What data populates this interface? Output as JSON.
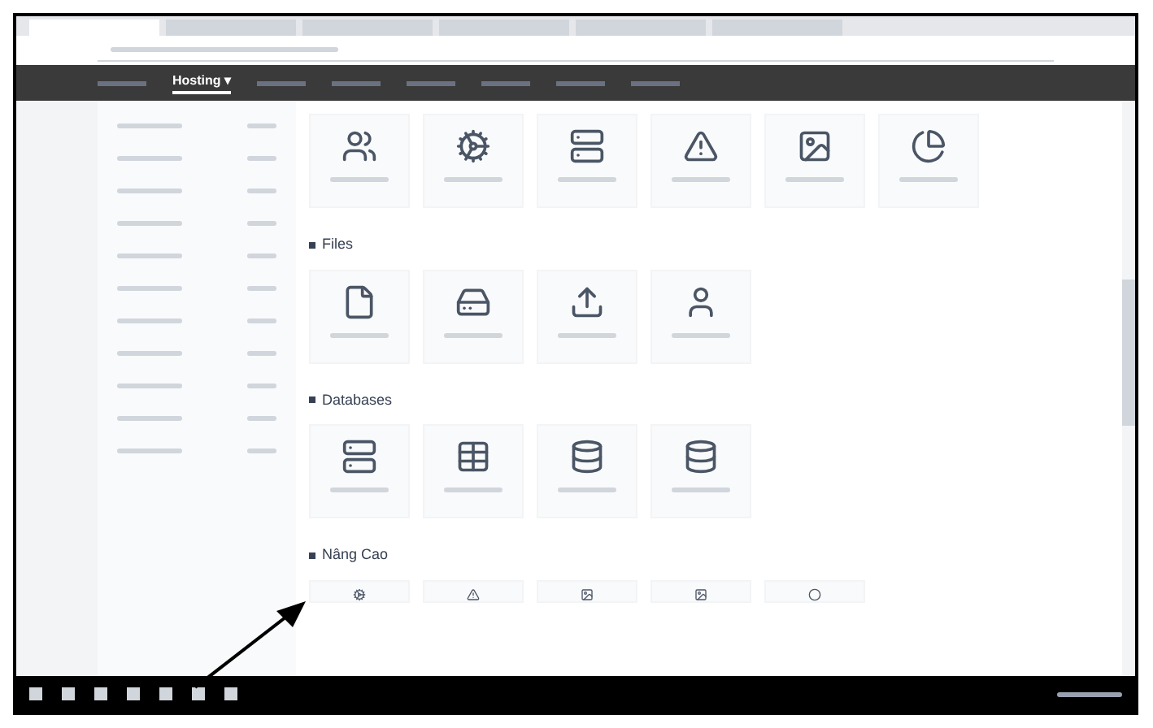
{
  "browser": {
    "tabs": [
      {
        "selected": true
      },
      {
        "selected": false
      },
      {
        "selected": false
      },
      {
        "selected": false
      },
      {
        "selected": false
      },
      {
        "selected": false
      }
    ]
  },
  "nav": {
    "items": [
      {
        "selected": false
      },
      {
        "label": "Hosting ▾",
        "selected": true
      },
      {
        "selected": false
      },
      {
        "selected": false
      },
      {
        "selected": false
      },
      {
        "selected": false
      },
      {
        "selected": false
      },
      {
        "selected": false
      }
    ]
  },
  "sections": [
    {
      "tiles": [
        {
          "kind": "users"
        },
        {
          "kind": "gears"
        },
        {
          "kind": "server"
        },
        {
          "kind": "alert"
        },
        {
          "kind": "image"
        },
        {
          "kind": "chart"
        }
      ]
    },
    {
      "title": "Files",
      "tiles": [
        {
          "kind": "file"
        },
        {
          "kind": "disk"
        },
        {
          "kind": "upload"
        },
        {
          "kind": "user"
        }
      ]
    },
    {
      "title": "Databases",
      "tiles": [
        {
          "kind": "server"
        },
        {
          "kind": "table"
        },
        {
          "kind": "db"
        },
        {
          "kind": "db"
        }
      ]
    },
    {
      "title": "Nâng Cao",
      "tiles": [
        {
          "kind": "gears"
        },
        {
          "kind": "alert"
        },
        {
          "kind": "image"
        },
        {
          "kind": "image"
        },
        {
          "kind": "circle"
        }
      ]
    }
  ]
}
